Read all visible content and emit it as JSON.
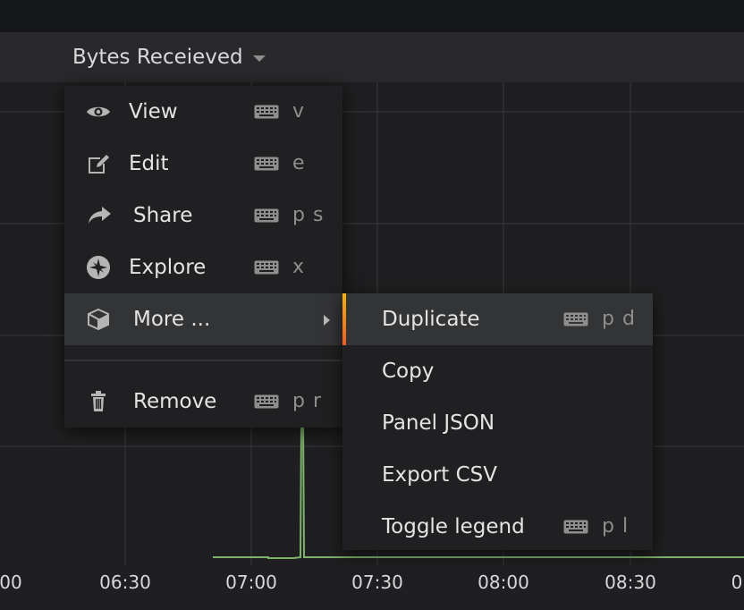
{
  "panel": {
    "title": "Bytes Receieved"
  },
  "x_axis": {
    "ticks": [
      "00",
      "06:30",
      "07:00",
      "07:30",
      "08:00",
      "08:30",
      "0"
    ]
  },
  "menu": {
    "items": [
      {
        "label": "View",
        "icon": "eye-icon",
        "shortcut": "v"
      },
      {
        "label": "Edit",
        "icon": "edit-icon",
        "shortcut": "e"
      },
      {
        "label": "Share",
        "icon": "share-icon",
        "shortcut": "p s"
      },
      {
        "label": "Explore",
        "icon": "compass-icon",
        "shortcut": "x"
      },
      {
        "label": "More ...",
        "icon": "cube-icon",
        "shortcut": ""
      },
      {
        "label": "Remove",
        "icon": "trash-icon",
        "shortcut": "p r"
      }
    ]
  },
  "submenu": {
    "items": [
      {
        "label": "Duplicate",
        "shortcut": "p d"
      },
      {
        "label": "Copy",
        "shortcut": ""
      },
      {
        "label": "Panel JSON",
        "shortcut": ""
      },
      {
        "label": "Export CSV",
        "shortcut": ""
      },
      {
        "label": "Toggle legend",
        "shortcut": "p l"
      }
    ]
  },
  "colors": {
    "background": "#161719",
    "panel_header": "#29292c",
    "menu_bg": "#202022",
    "menu_active": "#333436",
    "series_line": "#7eb26d",
    "accent_gradient_top": "#f4b400",
    "accent_gradient_bottom": "#f05a28"
  }
}
